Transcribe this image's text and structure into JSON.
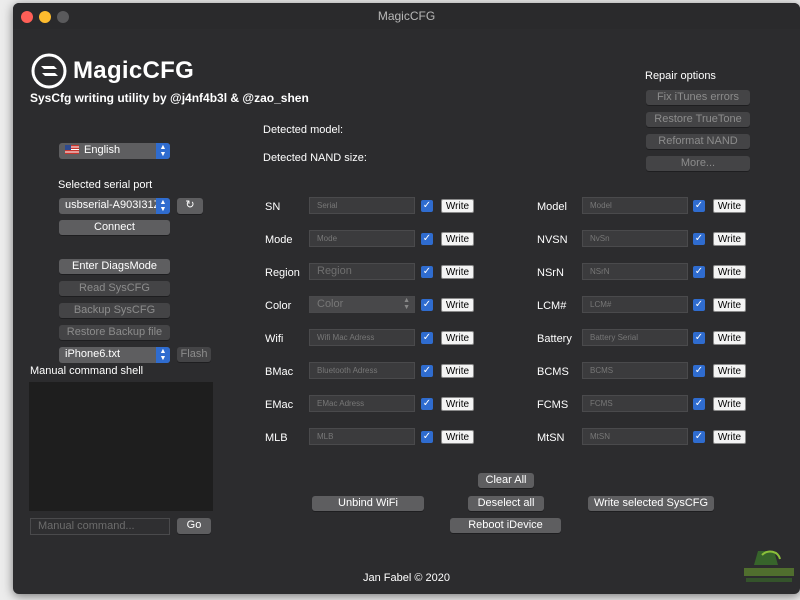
{
  "window": {
    "title": "MagicCFG"
  },
  "brand": {
    "name": "MagicCFG",
    "subtitle": "SysCfg writing utility by @j4nf4b3l & @zao_shen"
  },
  "language": {
    "value": "English",
    "flag": "flag-us-icon"
  },
  "serial": {
    "label": "Selected serial port",
    "port_value": "usbserial-A903I31Z",
    "refresh_icon": "refresh-icon",
    "connect_label": "Connect"
  },
  "actions": {
    "enter_diags": "Enter DiagsMode",
    "read_syscfg": "Read SysCFG",
    "backup_syscfg": "Backup SysCFG",
    "restore_backup": "Restore Backup file",
    "file_value": "iPhone6.txt",
    "flash_label": "Flash"
  },
  "shell": {
    "title": "Manual command shell",
    "placeholder": "Manual command...",
    "go_label": "Go"
  },
  "detected": {
    "model_label": "Detected model:",
    "nand_label": "Detected NAND size:"
  },
  "repair": {
    "title": "Repair options",
    "buttons": [
      "Fix iTunes errors",
      "Restore TrueTone",
      "Reformat NAND",
      "More..."
    ]
  },
  "fields_left": [
    {
      "label": "SN",
      "placeholder": "Serial",
      "checked": true,
      "write_label": "Write"
    },
    {
      "label": "Mode",
      "placeholder": "Mode",
      "checked": true,
      "write_label": "Write"
    },
    {
      "label": "Region",
      "placeholder": "Region",
      "checked": true,
      "write_label": "Write"
    },
    {
      "label": "Color",
      "placeholder": "Color",
      "checked": true,
      "write_label": "Write"
    },
    {
      "label": "Wifi",
      "placeholder": "Wifi Mac Adress",
      "checked": true,
      "write_label": "Write"
    },
    {
      "label": "BMac",
      "placeholder": "Bluetooth Adress",
      "checked": true,
      "write_label": "Write"
    },
    {
      "label": "EMac",
      "placeholder": "EMac Adress",
      "checked": true,
      "write_label": "Write"
    },
    {
      "label": "MLB",
      "placeholder": "MLB",
      "checked": true,
      "write_label": "Write"
    }
  ],
  "fields_right": [
    {
      "label": "Model",
      "placeholder": "Model",
      "checked": true,
      "write_label": "Write"
    },
    {
      "label": "NVSN",
      "placeholder": "NvSn",
      "checked": true,
      "write_label": "Write"
    },
    {
      "label": "NSrN",
      "placeholder": "NSrN",
      "checked": true,
      "write_label": "Write"
    },
    {
      "label": "LCM#",
      "placeholder": "LCM#",
      "checked": true,
      "write_label": "Write"
    },
    {
      "label": "Battery",
      "placeholder": "Battery Serial",
      "checked": true,
      "write_label": "Write"
    },
    {
      "label": "BCMS",
      "placeholder": "BCMS",
      "checked": true,
      "write_label": "Write"
    },
    {
      "label": "FCMS",
      "placeholder": "FCMS",
      "checked": true,
      "write_label": "Write"
    },
    {
      "label": "MtSN",
      "placeholder": "MtSN",
      "checked": true,
      "write_label": "Write"
    }
  ],
  "bottom": {
    "clear_all": "Clear All",
    "unbind_wifi": "Unbind WiFi",
    "deselect_all": "Deselect all",
    "write_selected": "Write selected SysCFG",
    "reboot": "Reboot iDevice"
  },
  "footer": "Jan Fabel © 2020",
  "colors": {
    "accent": "#2f6ccf",
    "window_bg": "#2c2c2e",
    "button_bg": "#5e5e60"
  }
}
